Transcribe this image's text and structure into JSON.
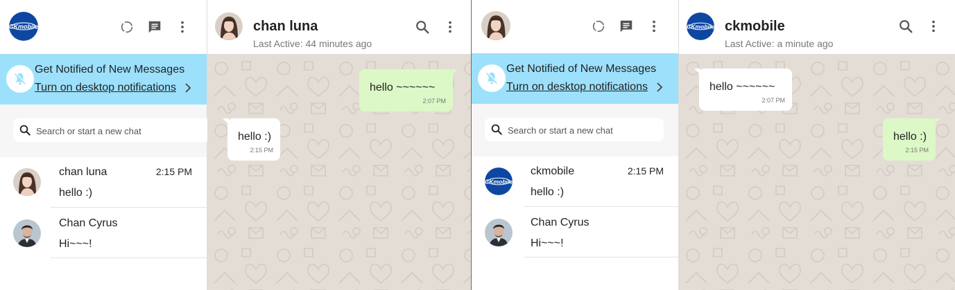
{
  "colors": {
    "notification_bg": "#9de0fc",
    "outgoing_bubble": "#dcf8c6",
    "incoming_bubble": "#ffffff",
    "chat_background": "#e4ddd6",
    "brand_blue": "#0d47a1"
  },
  "left": {
    "brand_logo_text": "CKmobile",
    "sidebar": {
      "notification": {
        "title": "Get Notified of New Messages",
        "link": "Turn on desktop notifications"
      },
      "search": {
        "placeholder": "Search or start a new chat"
      },
      "chats": [
        {
          "name": "chan luna",
          "preview": "hello :)",
          "time": "2:15 PM"
        },
        {
          "name": "Chan Cyrus",
          "preview": "Hi~~~!",
          "time": ""
        }
      ]
    },
    "conversation": {
      "name": "chan luna",
      "status": "Last Active: 44 minutes ago",
      "messages": [
        {
          "direction": "out",
          "text": "hello ~~~~~~",
          "time": "2:07 PM"
        },
        {
          "direction": "in",
          "text": "hello :)",
          "time": "2:15 PM"
        }
      ]
    }
  },
  "right": {
    "brand_logo_text": "CKmobile",
    "sidebar": {
      "notification": {
        "title": "Get Notified of New Messages",
        "link": "Turn on desktop notifications"
      },
      "search": {
        "placeholder": "Search or start a new chat"
      },
      "chats": [
        {
          "name": "ckmobile",
          "preview": "hello :)",
          "time": "2:15 PM"
        },
        {
          "name": "Chan Cyrus",
          "preview": "Hi~~~!",
          "time": ""
        }
      ]
    },
    "conversation": {
      "name": "ckmobile",
      "status": "Last Active: a minute ago",
      "messages": [
        {
          "direction": "in",
          "text": "hello ~~~~~~",
          "time": "2:07 PM"
        },
        {
          "direction": "out",
          "text": "hello :)",
          "time": "2:15 PM"
        }
      ]
    }
  }
}
